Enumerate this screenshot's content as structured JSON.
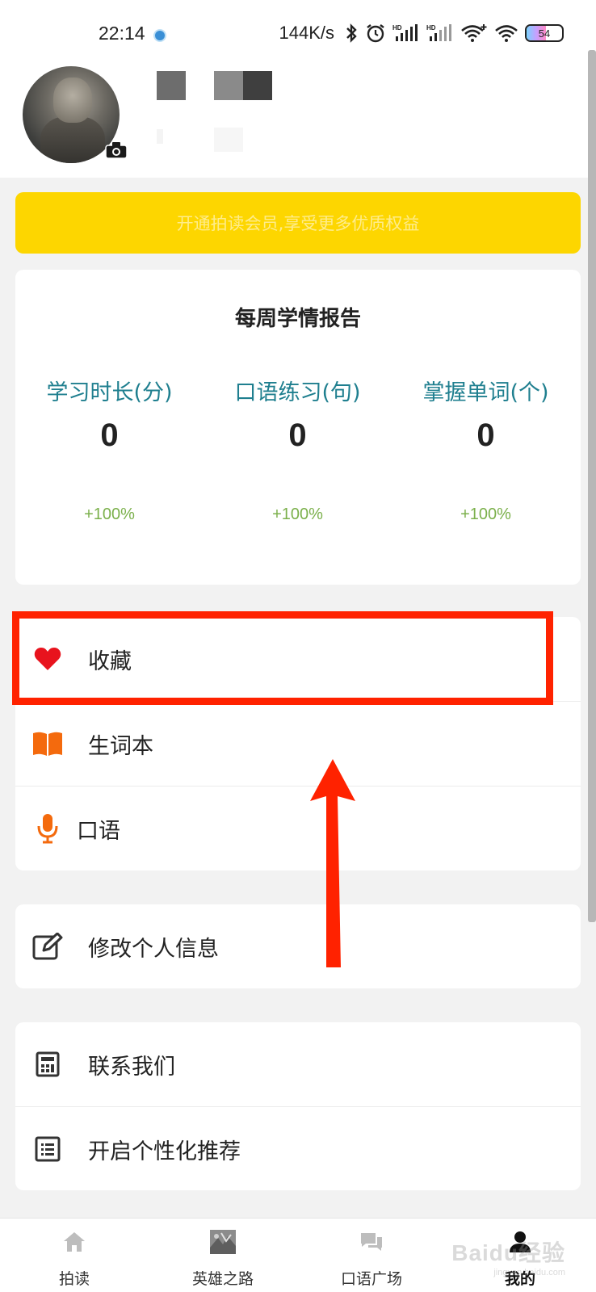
{
  "status_bar": {
    "time": "22:14",
    "network_speed": "144K/s",
    "battery_level": "54",
    "icons": [
      "app-notification-icon",
      "bluetooth-icon",
      "alarm-icon",
      "hd-signal-icon",
      "hd-signal-icon",
      "wifi-plus-icon",
      "wifi-icon",
      "battery-icon"
    ]
  },
  "profile": {
    "avatar": "user-avatar-photo",
    "camera_icon": "camera-icon"
  },
  "vip_banner": {
    "text": "开通拍读会员,享受更多优质权益"
  },
  "report": {
    "title": "每周学情报告",
    "stats": [
      {
        "label": "学习时长(分)",
        "value": "0",
        "change": "+100%"
      },
      {
        "label": "口语练习(句)",
        "value": "0",
        "change": "+100%"
      },
      {
        "label": "掌握单词(个)",
        "value": "0",
        "change": "+100%"
      }
    ]
  },
  "menu": {
    "group1": [
      {
        "label": "收藏",
        "icon": "heart-icon",
        "color": "#e8131d"
      },
      {
        "label": "生词本",
        "icon": "book-icon",
        "color": "#f46a0d"
      },
      {
        "label": "口语",
        "icon": "microphone-icon",
        "color": "#f46a0d"
      }
    ],
    "group2": [
      {
        "label": "修改个人信息",
        "icon": "edit-icon"
      }
    ],
    "group3": [
      {
        "label": "联系我们",
        "icon": "calculator-icon"
      },
      {
        "label": "开启个性化推荐",
        "icon": "list-icon"
      }
    ]
  },
  "bottom_nav": {
    "items": [
      {
        "label": "拍读",
        "icon": "home-icon"
      },
      {
        "label": "英雄之路",
        "icon": "hero-road-image-icon"
      },
      {
        "label": "口语广场",
        "icon": "chat-icon"
      },
      {
        "label": "我的",
        "icon": "user-icon",
        "active": true
      }
    ]
  },
  "watermark": {
    "text": "Baidu经验",
    "sub": "jingyan.baidu.com"
  },
  "colors": {
    "vip_yellow": "#fdd600",
    "stat_label_teal": "#1f7f8f",
    "change_green": "#7bb04b",
    "annotation_red": "#ff2200"
  }
}
